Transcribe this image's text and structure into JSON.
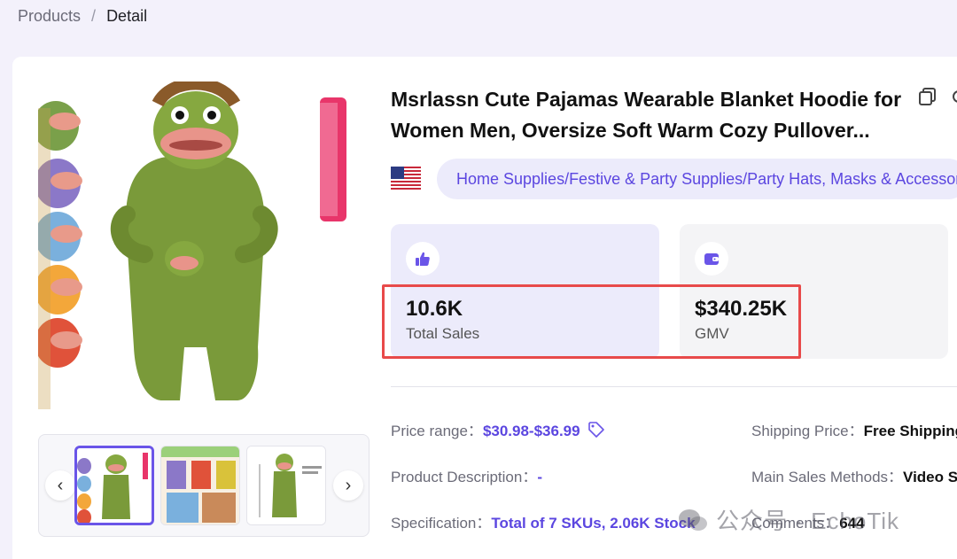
{
  "breadcrumb": {
    "parent": "Products",
    "separator": "/",
    "current": "Detail"
  },
  "product": {
    "title": "Msrlassn Cute Pajamas Wearable Blanket Hoodie for Women Men, Oversize Soft Warm Cozy Pullover...",
    "category": "Home Supplies/Festive & Party Supplies/Party Hats, Masks & Accessories",
    "flag": "us-flag-icon"
  },
  "stats": {
    "sales": {
      "value": "10.6K",
      "label": "Total Sales",
      "icon": "thumbs-up-icon"
    },
    "gmv": {
      "value": "$340.25K",
      "label": "GMV",
      "icon": "wallet-icon"
    }
  },
  "details": {
    "price_range_label": "Price range：",
    "price_range_value": "$30.98-$36.99",
    "shipping_label": "Shipping Price：",
    "shipping_value": "Free Shipping",
    "description_label": "Product Description：",
    "description_value": "-",
    "sales_methods_label": "Main Sales Methods：",
    "sales_methods_value": "Video Sa",
    "spec_label": "Specification：",
    "spec_value": "Total of 7 SKUs, 2.06K Stock",
    "comments_label": "Comments：",
    "comments_value": "644"
  },
  "watermark": "公众号 · EchoTik",
  "colors": {
    "accent": "#5b46e0",
    "highlight": "#e84a4a",
    "background": "#f3f1fb"
  }
}
